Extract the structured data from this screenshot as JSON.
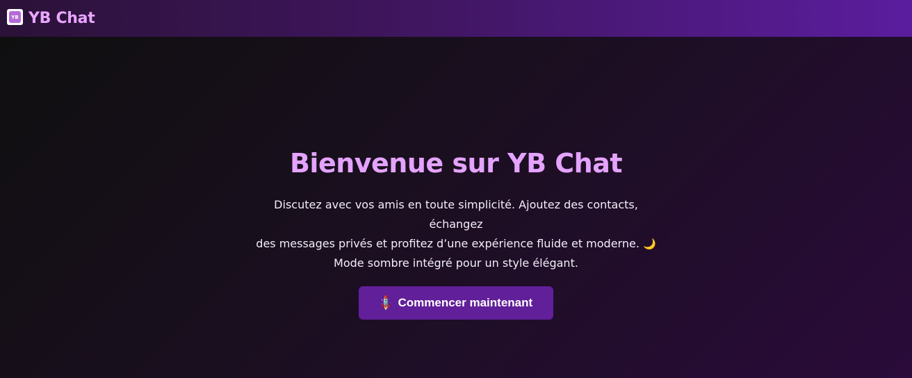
{
  "navbar": {
    "logo_text": "YB",
    "brand_name": "YB Chat"
  },
  "hero": {
    "title": "Bienvenue sur YB Chat",
    "description_line1": "Discutez avec vos amis en toute simplicité. Ajoutez des contacts, échangez",
    "description_line2": "des messages privés et profitez d’une expérience fluide et moderne.",
    "moon_emoji": "🌙",
    "description_line3": "Mode sombre intégré pour un style élégant.",
    "cta_icon": "🚀",
    "cta_label": "Commencer maintenant"
  },
  "colors": {
    "accent": "#e4a3ff",
    "button": "#611f99",
    "navbar_end": "#5b1d9e"
  }
}
